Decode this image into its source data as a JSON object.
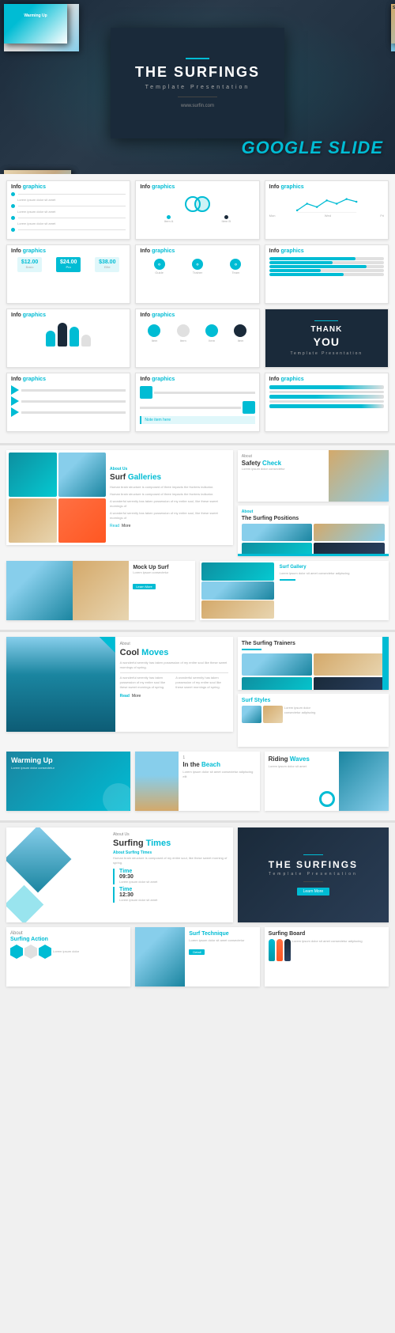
{
  "hero": {
    "title_line1": "THE SURFINGS",
    "title_line2": "Template Presentation",
    "url": "www.surfin.com",
    "google_badge": "GOOGLE SLIDE"
  },
  "infographics_section": {
    "label": "Info",
    "title_part1": "Info",
    "title_part2": "graphics"
  },
  "slides": {
    "thank_you": {
      "line1": "THANK",
      "line2": "YOU",
      "sub": "Template Presentation"
    },
    "surfings_dark": {
      "title": "THE SURFINGS",
      "sub": "Template Presentation"
    }
  },
  "feature_slides": {
    "surf_gallery": {
      "title_part1": "Surf",
      "title_part2": " Galleries",
      "text1": "Human brain structure is composed of three impacts the fronters indicator.",
      "text2": "Human brain structure is composed of three impacts the fronters indicator.",
      "text3": "A wonderful serenity has taken possession of my entire soul, like these sweet mornings of",
      "text4": "A wonderful serenity has taken possession of my entire soul, like these sweet mornings of"
    },
    "safety_check": {
      "title_part1": "Safety",
      "title_part2": " Check"
    },
    "surfing_positions": {
      "title": "The Surfing Positions"
    },
    "mock_up": {
      "title": "Mock Up Surf"
    },
    "cool_moves": {
      "title_part1": "Cool",
      "title_part2": " Moves",
      "text1": "A wonderful serenity has taken possession of my entire soul like these sweet mornings of spring.",
      "text2": "A wonderful serenity has taken possession of my entire soul like these sweet mornings of spring.",
      "text3": "A wonderful serenity has taken possession of my entire soul like these sweet mornings of spring.",
      "read": "Read",
      "more": "More"
    },
    "surfing_trainers": {
      "title": "The Surfing Trainers"
    },
    "warming_up": {
      "title": "Warming Up"
    },
    "in_the_beach": {
      "title_part1": "In the",
      "title_part2": " Beach"
    },
    "riding_waves": {
      "title_part1": "Riding",
      "title_part2": " Waves"
    },
    "surfing_times": {
      "title_part1": "Surfing",
      "title_part2": " Times",
      "sub_label": "About Surfing Times",
      "text1": "Human brain structure is composed of my entire soul, like these sweet morning of spring.",
      "time1_label": "Time",
      "time1_value": "09:30",
      "time1_desc1": "Lorem ipsum dolor sit amet",
      "time1_desc2": "consectetur adipiscing with",
      "time1_desc3": "dolor these three things.",
      "time2_label": "Time",
      "time2_value": "12:30",
      "time2_desc1": "Lorem ipsum dolor sit amet",
      "time2_desc2": "consectetur adipiscing with",
      "time2_desc3": "dolor these three things."
    },
    "surf_actions": {
      "title": "Surfing Action"
    },
    "surf_technique": {
      "title": "Surf Technique"
    },
    "surf_styles": {
      "title": "Surf Styles"
    },
    "surf_gallery2": {
      "title": "Surf Gallery"
    },
    "surfing_board": {
      "title": "Surfing Board"
    }
  }
}
